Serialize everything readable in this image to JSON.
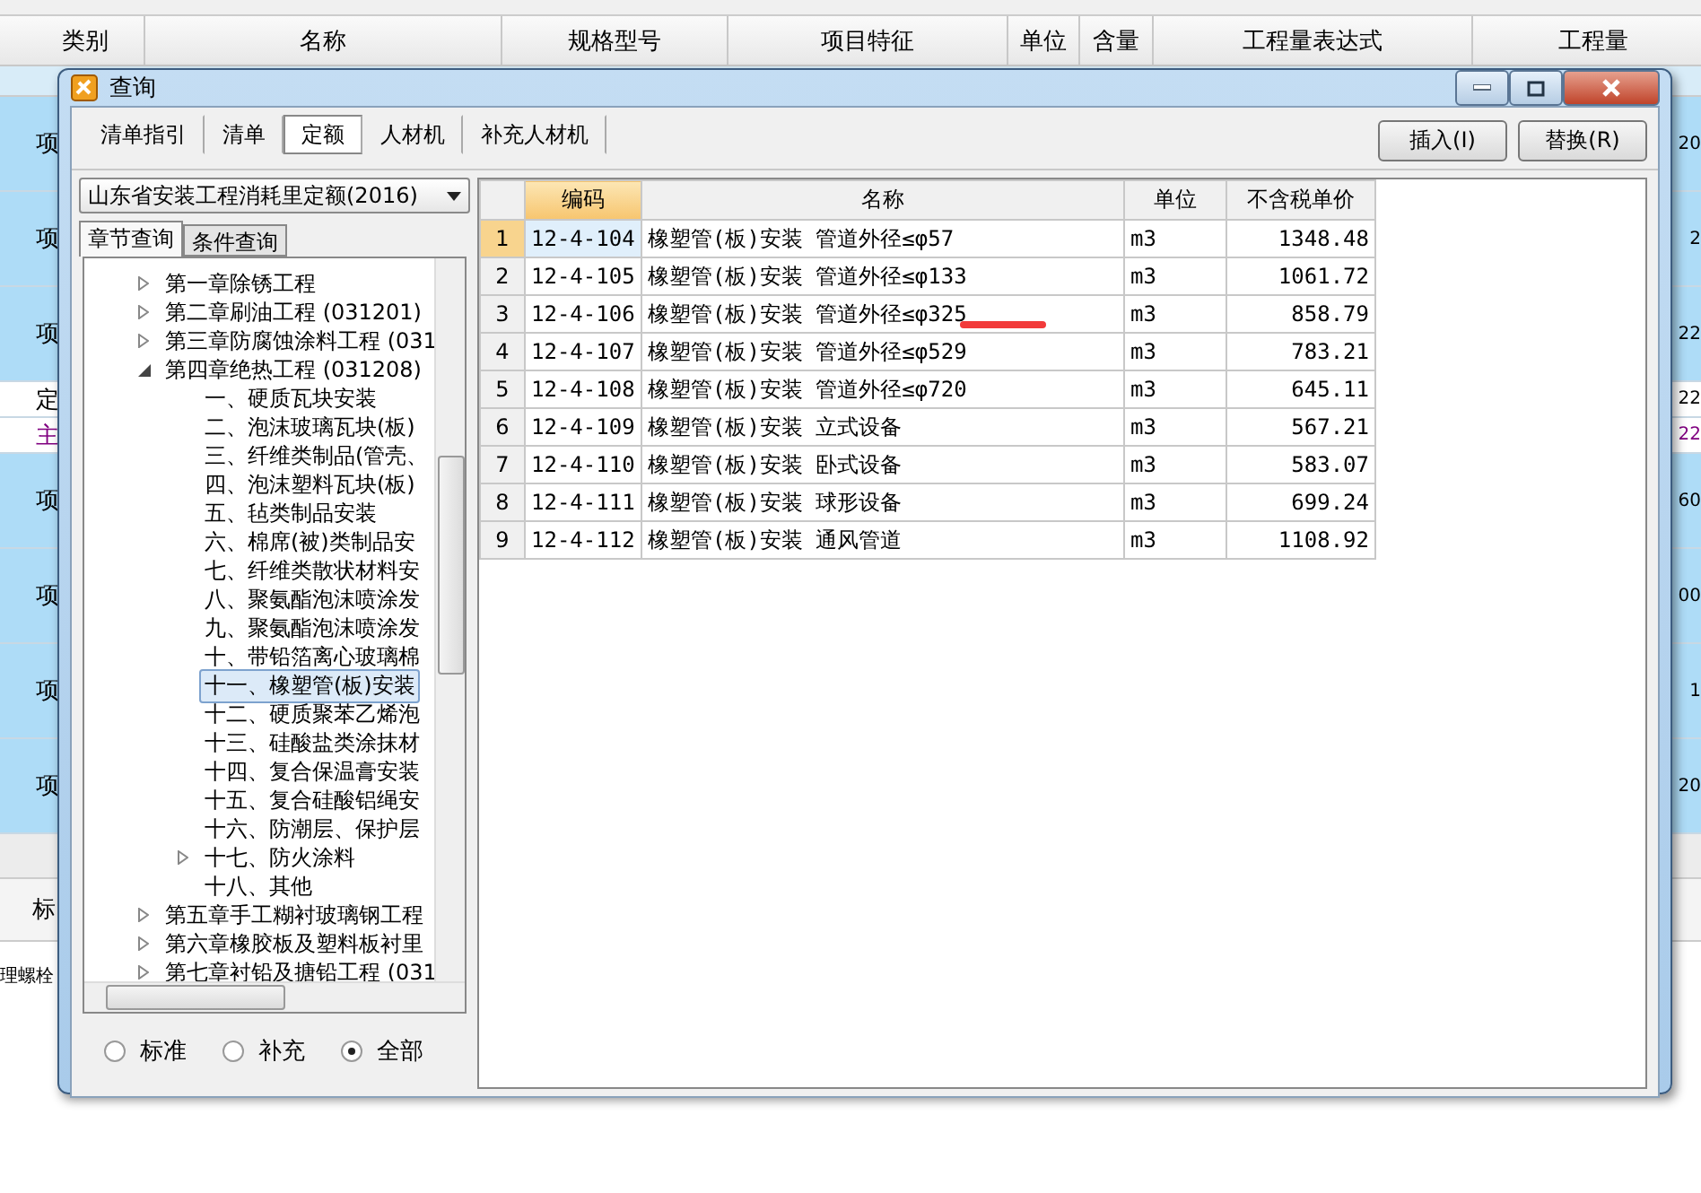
{
  "background": {
    "columns": [
      "类别",
      "名称",
      "规格型号",
      "项目特征",
      "单位",
      "含量",
      "工程量表达式",
      "工程量"
    ],
    "rows": [
      {
        "kind": "item",
        "category": "项",
        "quantity": "20"
      },
      {
        "kind": "item",
        "category": "项",
        "quantity": "2"
      },
      {
        "kind": "item",
        "category": "项",
        "quantity": "22"
      },
      {
        "kind": "sub",
        "category": "定",
        "quantity": "22"
      },
      {
        "kind": "main",
        "category": "主",
        "quantity": "22"
      },
      {
        "kind": "item",
        "category": "项",
        "quantity": "60"
      },
      {
        "kind": "item",
        "category": "项",
        "quantity": "00"
      },
      {
        "kind": "item",
        "category": "项",
        "quantity": "1"
      },
      {
        "kind": "item",
        "category": "项",
        "quantity": "20"
      }
    ],
    "bottom_tab": "标",
    "bottom_text": "理螺栓"
  },
  "dialog": {
    "title": "查询",
    "tabs": [
      {
        "label": "清单指引",
        "selected": false
      },
      {
        "label": "清单",
        "selected": false
      },
      {
        "label": "定额",
        "selected": true
      },
      {
        "label": "人材机",
        "selected": false
      },
      {
        "label": "补充人材机",
        "selected": false
      }
    ],
    "buttons": [
      "插入(I)",
      "替换(R)"
    ],
    "library": "山东省安装工程消耗里定额(2016)",
    "search_tabs": [
      {
        "label": "章节查询",
        "selected": true
      },
      {
        "label": "条件查询",
        "selected": false
      }
    ],
    "tree": [
      {
        "label": "第一章除锈工程",
        "expanded": false,
        "selected": false
      },
      {
        "label": "第二章刷油工程 (031201)",
        "expanded": false,
        "selected": false
      },
      {
        "label": "第三章防腐蚀涂料工程 (031",
        "expanded": false,
        "selected": false
      },
      {
        "label": "第四章绝热工程 (031208)",
        "expanded": true,
        "selected": false,
        "children": [
          {
            "label": "一、硬质瓦块安装",
            "selected": false
          },
          {
            "label": "二、泡沫玻璃瓦块(板)",
            "selected": false
          },
          {
            "label": "三、纤维类制品(管壳、",
            "selected": false
          },
          {
            "label": "四、泡沫塑料瓦块(板)",
            "selected": false
          },
          {
            "label": "五、毡类制品安装",
            "selected": false
          },
          {
            "label": "六、棉席(被)类制品安",
            "selected": false
          },
          {
            "label": "七、纤维类散状材料安",
            "selected": false
          },
          {
            "label": "八、聚氨酯泡沫喷涂发",
            "selected": false
          },
          {
            "label": "九、聚氨酯泡沫喷涂发",
            "selected": false
          },
          {
            "label": "十、带铅箔离心玻璃棉",
            "selected": false
          },
          {
            "label": "十一、橡塑管(板)安装",
            "selected": true
          },
          {
            "label": "十二、硬质聚苯乙烯泡",
            "selected": false
          },
          {
            "label": "十三、硅酸盐类涂抹材",
            "selected": false
          },
          {
            "label": "十四、复合保温膏安装",
            "selected": false
          },
          {
            "label": "十五、复合硅酸铝绳安",
            "selected": false
          },
          {
            "label": "十六、防潮层、保护层",
            "selected": false
          },
          {
            "label": "十七、防火涂料",
            "expanded": false,
            "selected": false
          },
          {
            "label": "十八、其他",
            "selected": false
          }
        ]
      },
      {
        "label": "第五章手工糊衬玻璃钢工程",
        "expanded": false,
        "selected": false
      },
      {
        "label": "第六章橡胶板及塑料板衬里",
        "expanded": false,
        "selected": false
      },
      {
        "label": "第七章衬铅及搪铅工程 (031",
        "expanded": false,
        "selected": false
      }
    ],
    "filters": [
      {
        "label": "标准",
        "selected": false
      },
      {
        "label": "补充",
        "selected": false
      },
      {
        "label": "全部",
        "selected": true
      }
    ],
    "table": {
      "columns": [
        "编码",
        "名称",
        "单位",
        "不含税单价"
      ],
      "rows": [
        {
          "index": "1",
          "code": "12-4-104",
          "name": "橡塑管(板)安装 管道外径≤φ57",
          "unit": "m3",
          "price": "1348.48",
          "selected": true
        },
        {
          "index": "2",
          "code": "12-4-105",
          "name": "橡塑管(板)安装 管道外径≤φ133",
          "unit": "m3",
          "price": "1061.72",
          "selected": false
        },
        {
          "index": "3",
          "code": "12-4-106",
          "name": "橡塑管(板)安装 管道外径≤φ325",
          "unit": "m3",
          "price": "858.79",
          "selected": false
        },
        {
          "index": "4",
          "code": "12-4-107",
          "name": "橡塑管(板)安装 管道外径≤φ529",
          "unit": "m3",
          "price": "783.21",
          "selected": false
        },
        {
          "index": "5",
          "code": "12-4-108",
          "name": "橡塑管(板)安装 管道外径≤φ720",
          "unit": "m3",
          "price": "645.11",
          "selected": false
        },
        {
          "index": "6",
          "code": "12-4-109",
          "name": "橡塑管(板)安装 立式设备",
          "unit": "m3",
          "price": "567.21",
          "selected": false
        },
        {
          "index": "7",
          "code": "12-4-110",
          "name": "橡塑管(板)安装 卧式设备",
          "unit": "m3",
          "price": "583.07",
          "selected": false
        },
        {
          "index": "8",
          "code": "12-4-111",
          "name": "橡塑管(板)安装 球形设备",
          "unit": "m3",
          "price": "699.24",
          "selected": false
        },
        {
          "index": "9",
          "code": "12-4-112",
          "name": "橡塑管(板)安装 通风管道",
          "unit": "m3",
          "price": "1108.92",
          "selected": false
        }
      ]
    }
  }
}
